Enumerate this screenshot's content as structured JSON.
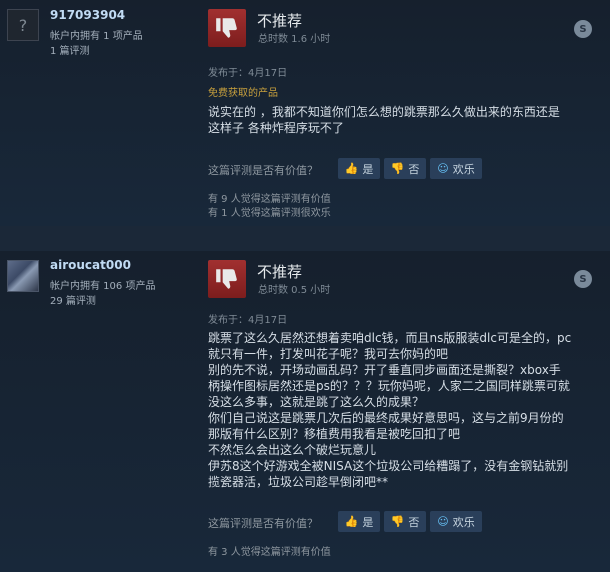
{
  "reviews": [
    {
      "username": "917093904",
      "products": "帐户内拥有 1 项产品",
      "review_count": "1 篇评测",
      "avatar_glyph": "?",
      "verdict": "不推荐",
      "hours": "总时数 1.6 小时",
      "posted": "发布于：4月17日",
      "free_label": "免费获取的产品",
      "body_lines": [
        "说实在的 ，我都不知道你们怎么想的跳票那么久做出来的东西还是",
        "这样子 各种炸程序玩不了"
      ],
      "helpful_question": "这篇评测是否有价值？",
      "btn_yes": "是",
      "btn_no": "否",
      "btn_funny": "欢乐",
      "helpful_count": "有 9 人觉得这篇评测有价值",
      "funny_count": "有 1 人觉得这篇评测很欢乐"
    },
    {
      "username": "airoucat000",
      "products": "帐户内拥有 106 项产品",
      "review_count": "29 篇评测",
      "verdict": "不推荐",
      "hours": "总时数 0.5 小时",
      "posted": "发布于：4月17日",
      "body_lines": [
        "跳票了这么久居然还想着卖咱dlc钱，而且ns版服装dlc可是全的，pc",
        "就只有一件，打发叫花子呢？我可去你妈的吧",
        "别的先不说，开场动画乱码？开了垂直同步画面还是撕裂？xbox手",
        "柄操作图标居然还是ps的？？？玩你妈呢，人家二之国同样跳票可就",
        "没这么多事，这就是跳了这么久的成果？",
        "你们自己说这是跳票几次后的最终成果好意思吗，这与之前9月份的",
        "那版有什么区别？移植费用我看是被吃回扣了吧",
        "不然怎么会出这么个破烂玩意儿",
        "伊苏8这个好游戏全被NISA这个垃圾公司给糟蹋了，没有金钢钻就别",
        "揽瓷器活，垃圾公司趁早倒闭吧**"
      ],
      "helpful_question": "这篇评测是否有价值？",
      "btn_yes": "是",
      "btn_no": "否",
      "btn_funny": "欢乐",
      "helpful_count": "有 3 人觉得这篇评测有价值"
    }
  ],
  "icons": {
    "thumbs_down": "thumbs-down-icon",
    "steam": "steam-icon",
    "thumbs_up_small": "thumbs-up-icon",
    "thumbs_down_small": "thumbs-down-icon",
    "funny": "smiley-icon"
  },
  "colors": {
    "background": "#1b2838",
    "thumb_red": "#a13030",
    "free_gold": "#c9a13d",
    "button": "#2a3f5a",
    "link_blue": "#66c0f4"
  }
}
